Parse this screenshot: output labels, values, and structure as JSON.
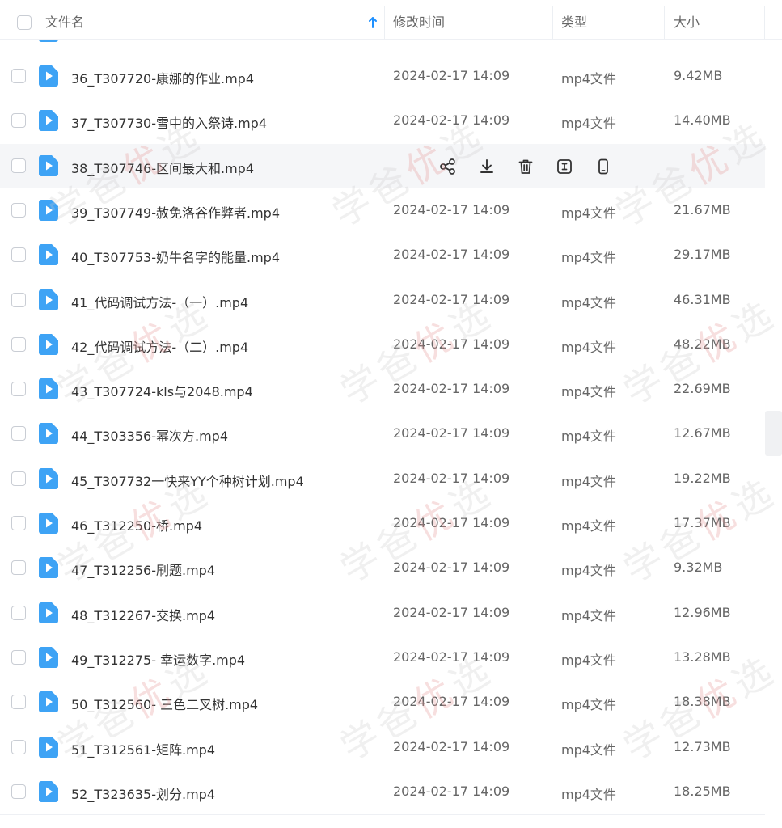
{
  "header": {
    "name_label": "文件名",
    "time_label": "修改时间",
    "type_label": "类型",
    "size_label": "大小",
    "sort_icon": "arrow-up-icon",
    "accent": "#1e90ff"
  },
  "rows": [
    {
      "name": "36_T307720-康娜的作业.mp4",
      "time": "2024-02-17 14:09",
      "type": "mp4文件",
      "size": "9.42MB"
    },
    {
      "name": "37_T307730-雪中的入祭诗.mp4",
      "time": "2024-02-17 14:09",
      "type": "mp4文件",
      "size": "14.40MB"
    },
    {
      "name": "38_T307746-区间最大和.mp4",
      "time": "",
      "type": "",
      "size": ""
    },
    {
      "name": "39_T307749-赦免洛谷作弊者.mp4",
      "time": "2024-02-17 14:09",
      "type": "mp4文件",
      "size": "21.67MB"
    },
    {
      "name": "40_T307753-奶牛名字的能量.mp4",
      "time": "2024-02-17 14:09",
      "type": "mp4文件",
      "size": "29.17MB"
    },
    {
      "name": "41_代码调试方法-（一）.mp4",
      "time": "2024-02-17 14:09",
      "type": "mp4文件",
      "size": "46.31MB"
    },
    {
      "name": "42_代码调试方法-（二）.mp4",
      "time": "2024-02-17 14:09",
      "type": "mp4文件",
      "size": "48.22MB"
    },
    {
      "name": "43_T307724-kls与2048.mp4",
      "time": "2024-02-17 14:09",
      "type": "mp4文件",
      "size": "22.69MB"
    },
    {
      "name": "44_T303356-幂次方.mp4",
      "time": "2024-02-17 14:09",
      "type": "mp4文件",
      "size": "12.67MB"
    },
    {
      "name": "45_T307732一快来YY个种树计划.mp4",
      "time": "2024-02-17 14:09",
      "type": "mp4文件",
      "size": "19.22MB"
    },
    {
      "name": "46_T312250-桥.mp4",
      "time": "2024-02-17 14:09",
      "type": "mp4文件",
      "size": "17.37MB"
    },
    {
      "name": "47_T312256-刷题.mp4",
      "time": "2024-02-17 14:09",
      "type": "mp4文件",
      "size": "9.32MB"
    },
    {
      "name": "48_T312267-交换.mp4",
      "time": "2024-02-17 14:09",
      "type": "mp4文件",
      "size": "12.96MB"
    },
    {
      "name": "49_T312275- 幸运数字.mp4",
      "time": "2024-02-17 14:09",
      "type": "mp4文件",
      "size": "13.28MB"
    },
    {
      "name": "50_T312560- 三色二叉树.mp4",
      "time": "2024-02-17 14:09",
      "type": "mp4文件",
      "size": "18.38MB"
    },
    {
      "name": "51_T312561-矩阵.mp4",
      "time": "2024-02-17 14:09",
      "type": "mp4文件",
      "size": "12.73MB"
    },
    {
      "name": "52_T323635-划分.mp4",
      "time": "2024-02-17 14:09",
      "type": "mp4文件",
      "size": "18.25MB"
    }
  ],
  "hover_actions": [
    "share-icon",
    "download-icon",
    "delete-icon",
    "rename-icon",
    "mobile-icon"
  ],
  "watermark": {
    "a": "学爸",
    "b": "优",
    "c": "选"
  },
  "colors": {
    "file_icon": "#3ea3f5",
    "text": "#333333",
    "muted": "#666666"
  }
}
